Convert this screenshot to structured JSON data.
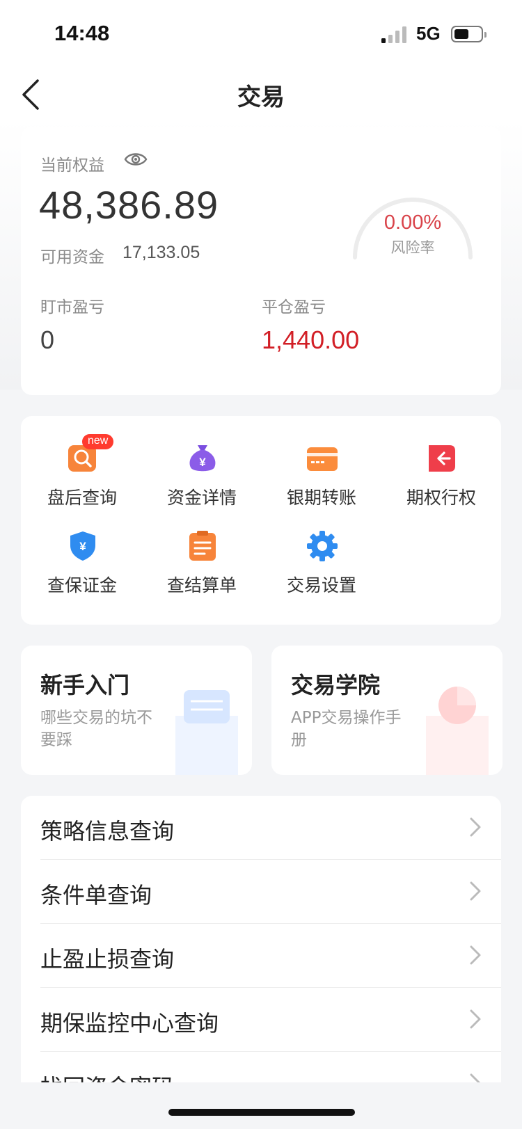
{
  "status_bar": {
    "time": "14:48",
    "network": "5G"
  },
  "nav": {
    "title": "交易"
  },
  "equity": {
    "label": "当前权益",
    "value": "48,386.89",
    "available_label": "可用资金",
    "available_value": "17,133.05",
    "risk_value": "0.00%",
    "risk_label": "风险率",
    "mark_pl_label": "盯市盈亏",
    "mark_pl_value": "0",
    "close_pl_label": "平仓盈亏",
    "close_pl_value": "1,440.00"
  },
  "tools": [
    {
      "label": "盘后查询",
      "icon": "search-doc-icon",
      "badge": "new"
    },
    {
      "label": "资金详情",
      "icon": "money-bag-icon"
    },
    {
      "label": "银期转账",
      "icon": "card-icon"
    },
    {
      "label": "期权行权",
      "icon": "exercise-arrow-icon"
    },
    {
      "label": "查保证金",
      "icon": "shield-yen-icon"
    },
    {
      "label": "查结算单",
      "icon": "clipboard-icon"
    },
    {
      "label": "交易设置",
      "icon": "gear-icon"
    }
  ],
  "promos": [
    {
      "title": "新手入门",
      "subtitle": "哪些交易的坑不要踩"
    },
    {
      "title": "交易学院",
      "subtitle": "APP交易操作手册"
    }
  ],
  "list": [
    {
      "label": "策略信息查询"
    },
    {
      "label": "条件单查询"
    },
    {
      "label": "止盈止损查询"
    },
    {
      "label": "期保监控中心查询"
    },
    {
      "label": "找回资金密码"
    }
  ],
  "colors": {
    "accent_red": "#d21f26",
    "risk_red": "#d9434a",
    "orange": "#f7843a",
    "blue": "#2f8cf0",
    "purple": "#8b5ce8"
  }
}
